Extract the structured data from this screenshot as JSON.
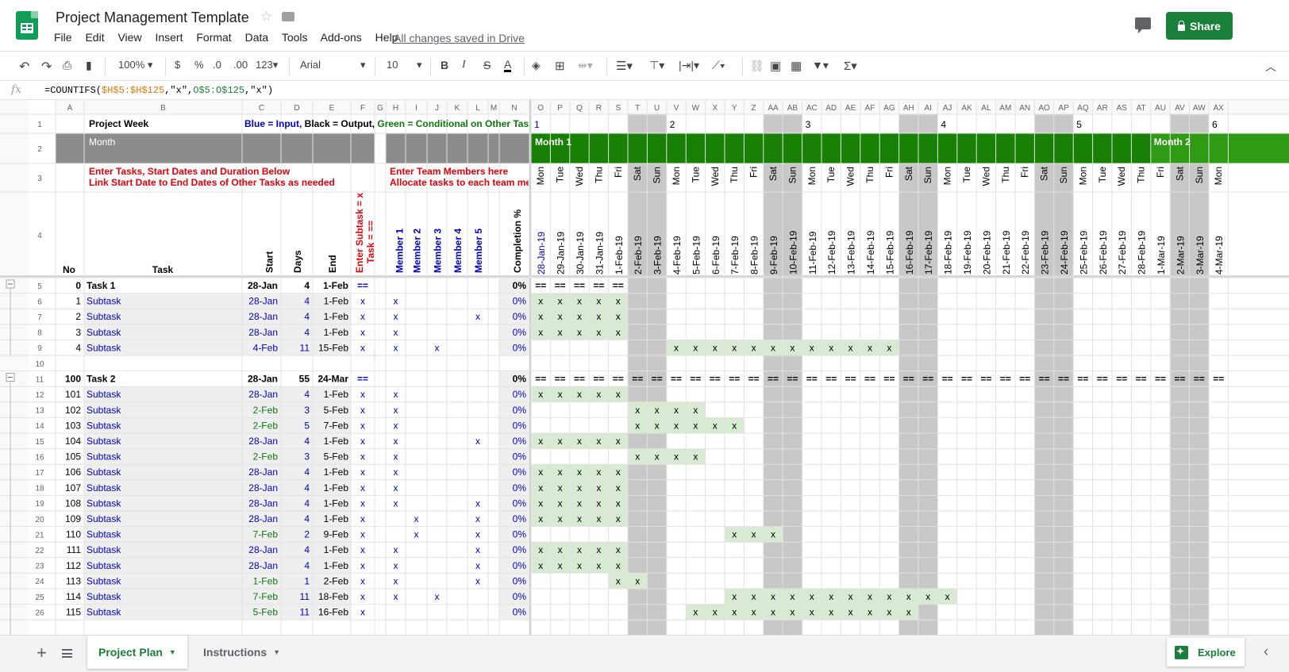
{
  "app": {
    "title": "Project Management Template",
    "menu": [
      "File",
      "Edit",
      "View",
      "Insert",
      "Format",
      "Data",
      "Tools",
      "Add-ons",
      "Help"
    ],
    "saved_status": "All changes saved in Drive",
    "share_label": "Share"
  },
  "toolbar": {
    "zoom": "100%",
    "currency": "$",
    "percent": "%",
    "dec_decrease": ".0",
    "dec_increase": ".00",
    "more_formats": "123",
    "font": "Arial",
    "font_size": "10",
    "bold": "B",
    "italic": "I",
    "strike": "S",
    "text_color": "A"
  },
  "formula_bar": {
    "fx": "fx",
    "parts": [
      "=COUNTIFS(",
      "$H$5:$H$125",
      ",\"x\",",
      "O$5:O$125",
      ",\"x\")"
    ]
  },
  "sheet": {
    "fixed_cols": [
      "A",
      "B",
      "C",
      "D",
      "E",
      "F",
      "G",
      "H",
      "I",
      "J",
      "K",
      "L",
      "M",
      "N"
    ],
    "day_cols": [
      "O",
      "P",
      "Q",
      "R",
      "S",
      "T",
      "U",
      "V",
      "W",
      "X",
      "Y",
      "Z",
      "AA",
      "AB",
      "AC",
      "AD",
      "AE",
      "AF",
      "AG",
      "AH",
      "AI",
      "AJ",
      "AK",
      "AL",
      "AM",
      "AN",
      "AO",
      "AP",
      "AQ",
      "AR",
      "AS",
      "AT",
      "AU",
      "AV",
      "AW",
      "AX"
    ],
    "row1": {
      "project_week": "Project Week",
      "legend": [
        "Blue = Input, ",
        "Black = Output, ",
        "Green = Conditional on Other Tas"
      ],
      "week_numbers": [
        "1",
        "2",
        "3",
        "4",
        "5",
        "6"
      ]
    },
    "row2": {
      "month_label": "Month",
      "month1": "Month 1",
      "month2": "Month 2"
    },
    "row3": {
      "task_instructions": [
        "Enter Tasks, Start Dates and Duration Below",
        "Link Start Date to End Dates of Other Tasks as needed"
      ],
      "team_instructions": [
        "Enter Team Members here",
        "Allocate tasks to each team me"
      ]
    },
    "day_names": [
      "Mon",
      "Tue",
      "Wed",
      "Thu",
      "Fri",
      "Sat",
      "Sun",
      "Mon",
      "Tue",
      "Wed",
      "Thu",
      "Fri",
      "Sat",
      "Sun",
      "Mon",
      "Tue",
      "Wed",
      "Thu",
      "Fri",
      "Sat",
      "Sun",
      "Mon",
      "Tue",
      "Wed",
      "Thu",
      "Fri",
      "Sat",
      "Sun",
      "Mon",
      "Tue",
      "Wed",
      "Thu",
      "Fri",
      "Sat",
      "Sun",
      "Mon"
    ],
    "dates": [
      "28-Jan-19",
      "29-Jan-19",
      "30-Jan-19",
      "31-Jan-19",
      "1-Feb-19",
      "2-Feb-19",
      "3-Feb-19",
      "4-Feb-19",
      "5-Feb-19",
      "6-Feb-19",
      "7-Feb-19",
      "8-Feb-19",
      "9-Feb-19",
      "10-Feb-19",
      "11-Feb-19",
      "12-Feb-19",
      "13-Feb-19",
      "14-Feb-19",
      "15-Feb-19",
      "16-Feb-19",
      "17-Feb-19",
      "18-Feb-19",
      "19-Feb-19",
      "20-Feb-19",
      "21-Feb-19",
      "22-Feb-19",
      "23-Feb-19",
      "24-Feb-19",
      "25-Feb-19",
      "26-Feb-19",
      "27-Feb-19",
      "28-Feb-19",
      "1-Mar-19",
      "2-Mar-19",
      "3-Mar-19",
      "4-Mar-19"
    ],
    "headers": {
      "no": "No",
      "task": "Task",
      "start": "Start",
      "days": "Days",
      "end": "End",
      "subtask_flag": [
        "Enter Subtask = x",
        "Task = =="
      ],
      "members": [
        "Member 1",
        "Member 2",
        "Member 3",
        "Member 4",
        "Member 5"
      ],
      "completion": "Completion %"
    },
    "rows": [
      {
        "row": "5",
        "type": "task",
        "no": "0",
        "task": "Task 1",
        "start": "28-Jan",
        "days": "4",
        "end": "1-Feb",
        "flag": "==",
        "members": [
          "",
          "",
          "",
          "",
          ""
        ],
        "completion": "0%",
        "gantt": [
          0,
          4
        ]
      },
      {
        "row": "6",
        "type": "sub",
        "no": "1",
        "task": "Subtask",
        "start": "28-Jan",
        "days": "4",
        "end": "1-Feb",
        "flag": "x",
        "members": [
          "x",
          "",
          "",
          "",
          ""
        ],
        "completion": "0%",
        "gantt": [
          0,
          4
        ]
      },
      {
        "row": "7",
        "type": "sub",
        "no": "2",
        "task": "Subtask",
        "start": "28-Jan",
        "days": "4",
        "end": "1-Feb",
        "flag": "x",
        "members": [
          "x",
          "",
          "",
          "",
          "x"
        ],
        "completion": "0%",
        "gantt": [
          0,
          4
        ]
      },
      {
        "row": "8",
        "type": "sub",
        "no": "3",
        "task": "Subtask",
        "start": "28-Jan",
        "days": "4",
        "end": "1-Feb",
        "flag": "x",
        "members": [
          "x",
          "",
          "",
          "",
          ""
        ],
        "completion": "0%",
        "gantt": [
          0,
          4
        ]
      },
      {
        "row": "9",
        "type": "sub",
        "no": "4",
        "task": "Subtask",
        "start": "4-Feb",
        "days": "11",
        "end": "15-Feb",
        "flag": "x",
        "members": [
          "x",
          "",
          "x",
          "",
          ""
        ],
        "completion": "0%",
        "gantt": [
          7,
          18
        ]
      },
      {
        "row": "10",
        "type": "empty"
      },
      {
        "row": "11",
        "type": "task",
        "no": "100",
        "task": "Task 2",
        "start": "28-Jan",
        "days": "55",
        "end": "24-Mar",
        "flag": "==",
        "members": [
          "",
          "",
          "",
          "",
          ""
        ],
        "completion": "0%",
        "gantt": [
          0,
          35
        ]
      },
      {
        "row": "12",
        "type": "sub",
        "no": "101",
        "task": "Subtask",
        "start": "28-Jan",
        "days": "4",
        "end": "1-Feb",
        "flag": "x",
        "members": [
          "x",
          "",
          "",
          "",
          ""
        ],
        "completion": "0%",
        "gantt": [
          0,
          4
        ]
      },
      {
        "row": "13",
        "type": "sub",
        "startGreen": true,
        "no": "102",
        "task": "Subtask",
        "start": "2-Feb",
        "days": "3",
        "end": "5-Feb",
        "flag": "x",
        "members": [
          "x",
          "",
          "",
          "",
          ""
        ],
        "completion": "0%",
        "gantt": [
          5,
          8
        ]
      },
      {
        "row": "14",
        "type": "sub",
        "startGreen": true,
        "no": "103",
        "task": "Subtask",
        "start": "2-Feb",
        "days": "5",
        "end": "7-Feb",
        "flag": "x",
        "members": [
          "x",
          "",
          "",
          "",
          ""
        ],
        "completion": "0%",
        "gantt": [
          5,
          10
        ]
      },
      {
        "row": "15",
        "type": "sub",
        "no": "104",
        "task": "Subtask",
        "start": "28-Jan",
        "days": "4",
        "end": "1-Feb",
        "flag": "x",
        "members": [
          "x",
          "",
          "",
          "",
          "x"
        ],
        "completion": "0%",
        "gantt": [
          0,
          4
        ]
      },
      {
        "row": "16",
        "type": "sub",
        "startGreen": true,
        "no": "105",
        "task": "Subtask",
        "start": "2-Feb",
        "days": "3",
        "end": "5-Feb",
        "flag": "x",
        "members": [
          "x",
          "",
          "",
          "",
          ""
        ],
        "completion": "0%",
        "gantt": [
          5,
          8
        ]
      },
      {
        "row": "17",
        "type": "sub",
        "no": "106",
        "task": "Subtask",
        "start": "28-Jan",
        "days": "4",
        "end": "1-Feb",
        "flag": "x",
        "members": [
          "x",
          "",
          "",
          "",
          ""
        ],
        "completion": "0%",
        "gantt": [
          0,
          4
        ]
      },
      {
        "row": "18",
        "type": "sub",
        "no": "107",
        "task": "Subtask",
        "start": "28-Jan",
        "days": "4",
        "end": "1-Feb",
        "flag": "x",
        "members": [
          "x",
          "",
          "",
          "",
          ""
        ],
        "completion": "0%",
        "gantt": [
          0,
          4
        ]
      },
      {
        "row": "19",
        "type": "sub",
        "no": "108",
        "task": "Subtask",
        "start": "28-Jan",
        "days": "4",
        "end": "1-Feb",
        "flag": "x",
        "members": [
          "x",
          "",
          "",
          "",
          "x"
        ],
        "completion": "0%",
        "gantt": [
          0,
          4
        ]
      },
      {
        "row": "20",
        "type": "sub",
        "no": "109",
        "task": "Subtask",
        "start": "28-Jan",
        "days": "4",
        "end": "1-Feb",
        "flag": "x",
        "members": [
          "",
          "x",
          "",
          "",
          "x"
        ],
        "completion": "0%",
        "gantt": [
          0,
          4
        ]
      },
      {
        "row": "21",
        "type": "sub",
        "startGreen": true,
        "no": "110",
        "task": "Subtask",
        "start": "7-Feb",
        "days": "2",
        "end": "9-Feb",
        "flag": "x",
        "members": [
          "",
          "x",
          "",
          "",
          "x"
        ],
        "completion": "0%",
        "gantt": [
          10,
          12
        ]
      },
      {
        "row": "22",
        "type": "sub",
        "no": "111",
        "task": "Subtask",
        "start": "28-Jan",
        "days": "4",
        "end": "1-Feb",
        "flag": "x",
        "members": [
          "x",
          "",
          "",
          "",
          "x"
        ],
        "completion": "0%",
        "gantt": [
          0,
          4
        ]
      },
      {
        "row": "23",
        "type": "sub",
        "no": "112",
        "task": "Subtask",
        "start": "28-Jan",
        "days": "4",
        "end": "1-Feb",
        "flag": "x",
        "members": [
          "x",
          "",
          "",
          "",
          "x"
        ],
        "completion": "0%",
        "gantt": [
          0,
          4
        ]
      },
      {
        "row": "24",
        "type": "sub",
        "startGreen": true,
        "no": "113",
        "task": "Subtask",
        "start": "1-Feb",
        "days": "1",
        "end": "2-Feb",
        "flag": "x",
        "members": [
          "x",
          "",
          "",
          "",
          "x"
        ],
        "completion": "0%",
        "gantt": [
          4,
          5
        ]
      },
      {
        "row": "25",
        "type": "sub",
        "startGreen": true,
        "no": "114",
        "task": "Subtask",
        "start": "7-Feb",
        "days": "11",
        "end": "18-Feb",
        "flag": "x",
        "members": [
          "x",
          "",
          "x",
          "",
          ""
        ],
        "completion": "0%",
        "gantt": [
          10,
          21
        ]
      },
      {
        "row": "26",
        "type": "sub",
        "startGreen": true,
        "no": "115",
        "task": "Subtask",
        "start": "5-Feb",
        "days": "11",
        "end": "16-Feb",
        "flag": "x",
        "members": [
          "",
          "",
          "",
          "",
          ""
        ],
        "completion": "0%",
        "gantt": [
          8,
          19
        ]
      }
    ]
  },
  "tabs": {
    "sheets": [
      "Project Plan",
      "Instructions"
    ],
    "explore": "Explore"
  },
  "colors": {
    "input_blue": "#0000cc",
    "conditional_green": "#0b7a0b",
    "warning_red": "#e8000b",
    "month_bar": "#188005",
    "weekend": "#c8c8c8",
    "gantt_fill": "#d9ead3"
  }
}
